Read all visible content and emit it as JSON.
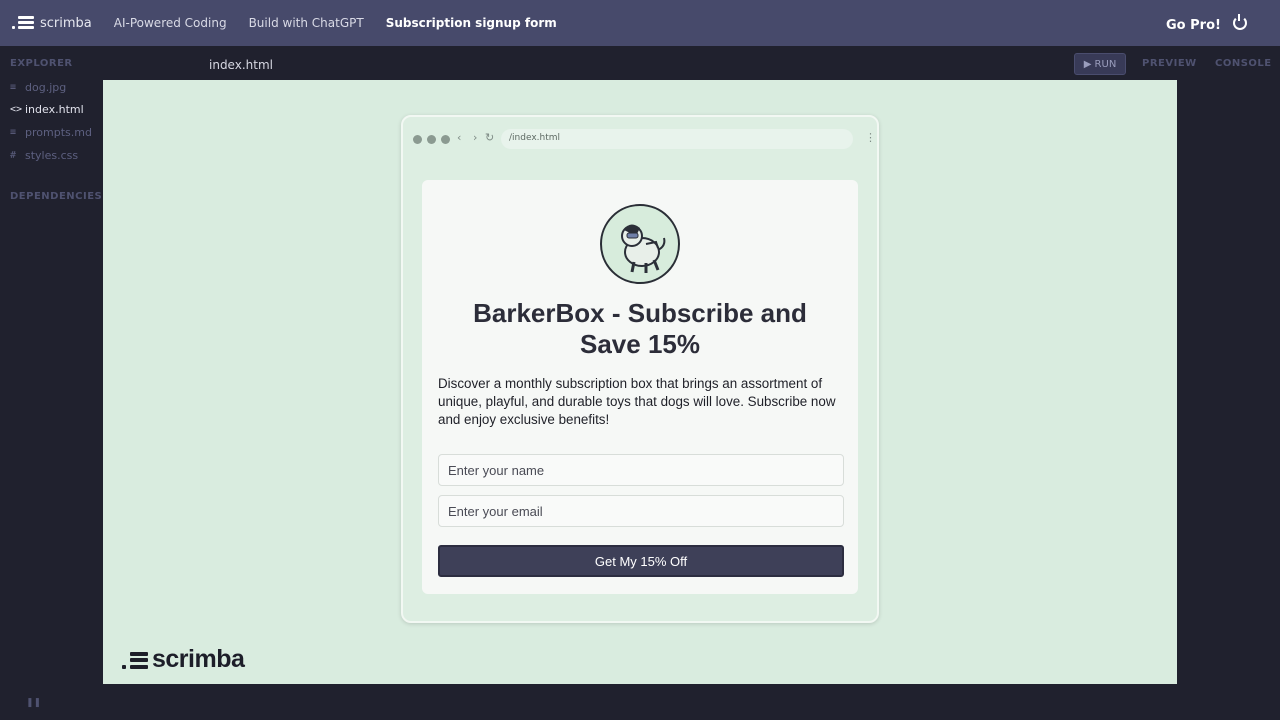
{
  "topbar": {
    "brand": "scrimba",
    "breadcrumbs": [
      "AI-Powered Coding",
      "Build with ChatGPT",
      "Subscription signup form"
    ],
    "go_pro": "Go Pro!"
  },
  "sidebar": {
    "title": "EXPLORER",
    "files": [
      {
        "icon": "≡",
        "name": "dog.jpg"
      },
      {
        "icon": "<>",
        "name": "index.html"
      },
      {
        "icon": "≡",
        "name": "prompts.md"
      },
      {
        "icon": "#",
        "name": "styles.css"
      }
    ],
    "dependencies": "DEPENDENCIES"
  },
  "editor": {
    "tab": "index.html",
    "run": "▶ RUN",
    "preview": "PREVIEW",
    "console": "CONSOLE"
  },
  "browser": {
    "url": "/index.html"
  },
  "signup": {
    "headline": "BarkerBox - Subscribe and Save 15%",
    "description": "Discover a monthly subscription box that brings an assortment of unique, playful, and durable toys that dogs will love. Subscribe now and enjoy exclusive benefits!",
    "name_placeholder": "Enter your name",
    "email_placeholder": "Enter your email",
    "cta": "Get My 15% Off"
  },
  "watermark": "scrimba",
  "colors": {
    "topbar": "#474a6b",
    "app_bg": "#20212e",
    "preview_bg": "#d9ecdf",
    "cta_bg": "#3e4058"
  }
}
